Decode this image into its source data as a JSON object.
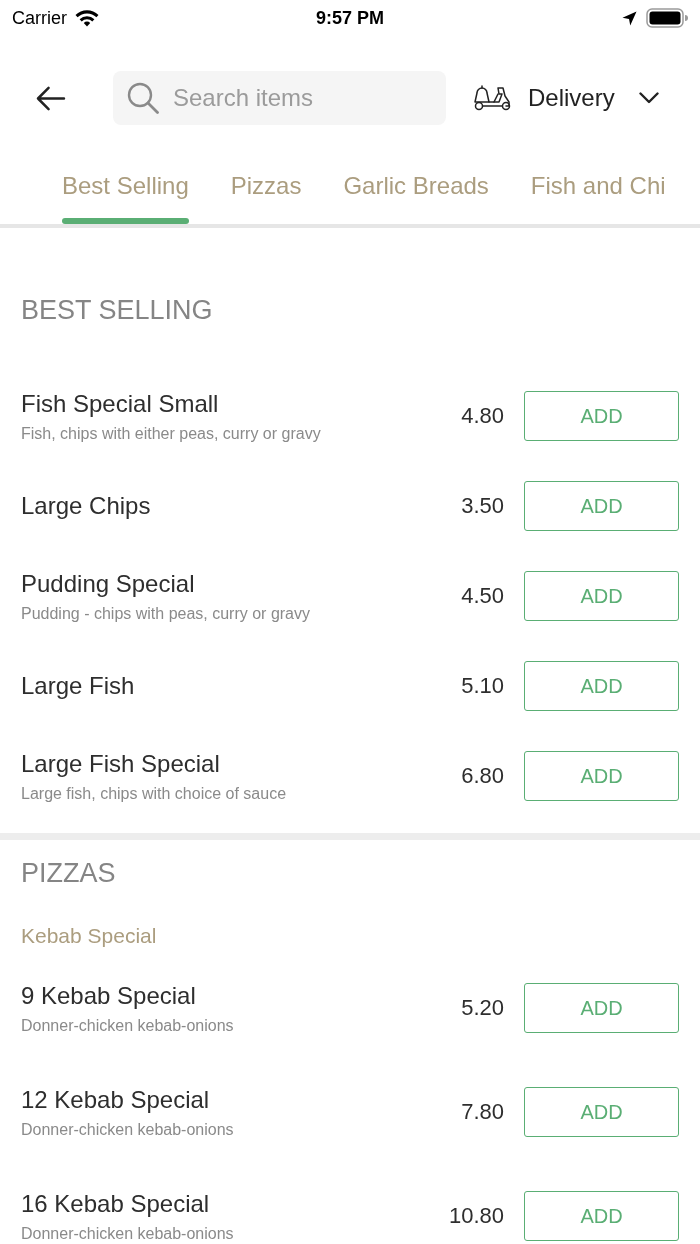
{
  "status_bar": {
    "carrier": "Carrier",
    "time": "9:57 PM"
  },
  "header": {
    "search": {
      "placeholder": "Search items"
    },
    "order_type": "Delivery"
  },
  "tabs": [
    {
      "label": "Best Selling",
      "selected": true
    },
    {
      "label": "Pizzas",
      "selected": false
    },
    {
      "label": "Garlic Breads",
      "selected": false
    },
    {
      "label": "Fish and Chi",
      "selected": false
    }
  ],
  "sections": [
    {
      "title": "BEST SELLING",
      "items": [
        {
          "name": "Fish Special Small",
          "description": "Fish, chips with either peas, curry or gravy",
          "price": "4.80",
          "button": "ADD"
        },
        {
          "name": "Large Chips",
          "price": "3.50",
          "button": "ADD"
        },
        {
          "name": "Pudding Special",
          "description": "Pudding - chips with peas, curry or gravy",
          "price": "4.50",
          "button": "ADD"
        },
        {
          "name": "Large Fish",
          "price": "5.10",
          "button": "ADD"
        },
        {
          "name": "Large Fish Special",
          "description": "Large fish, chips with choice of sauce",
          "price": "6.80",
          "button": "ADD"
        }
      ]
    },
    {
      "title": "PIZZAS",
      "groups": [
        {
          "title": "Kebab Special",
          "items": [
            {
              "name": "9 Kebab Special",
              "description": "Donner-chicken kebab-onions",
              "price": "5.20",
              "button": "ADD"
            },
            {
              "name": "12 Kebab Special",
              "description": "Donner-chicken kebab-onions",
              "price": "7.80",
              "button": "ADD"
            },
            {
              "name": "16 Kebab Special",
              "description": "Donner-chicken kebab-onions",
              "price": "10.80",
              "button": "ADD"
            }
          ]
        }
      ]
    }
  ]
}
